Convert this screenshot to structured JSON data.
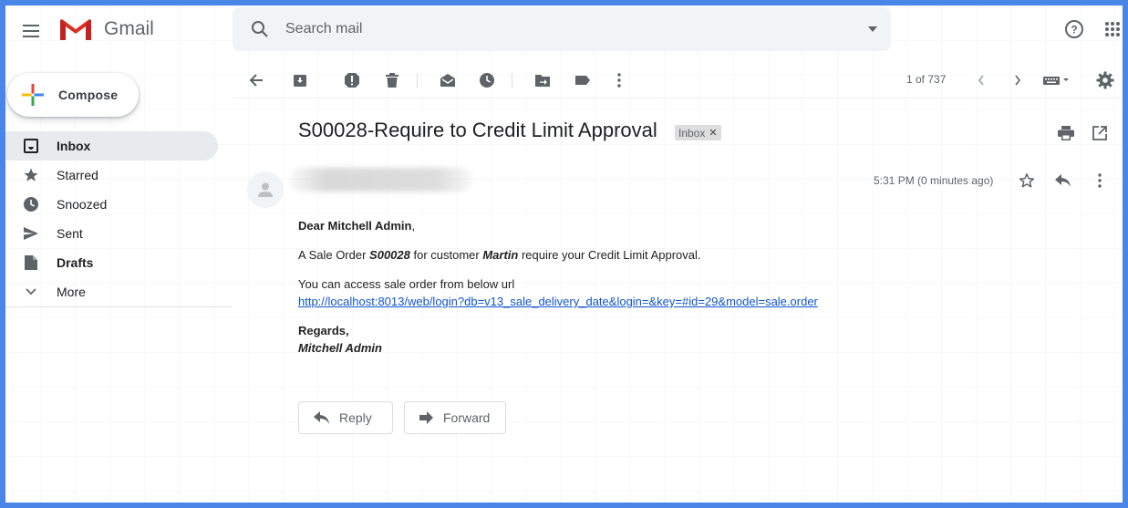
{
  "app": {
    "name": "Gmail"
  },
  "search": {
    "placeholder": "Search mail"
  },
  "compose": {
    "label": "Compose"
  },
  "sidebar": {
    "items": [
      {
        "label": "Inbox",
        "icon": "inbox-icon",
        "active": true
      },
      {
        "label": "Starred",
        "icon": "star-icon"
      },
      {
        "label": "Snoozed",
        "icon": "clock-icon"
      },
      {
        "label": "Sent",
        "icon": "send-icon"
      },
      {
        "label": "Drafts",
        "icon": "draft-icon"
      },
      {
        "label": "More",
        "icon": "chevron-down-icon"
      }
    ]
  },
  "toolbar": {
    "pager": "1 of 737"
  },
  "message": {
    "subject": "S00028-Require to Credit Limit Approval",
    "label_badge": "Inbox",
    "time": "5:31 PM (0 minutes ago)",
    "greeting_name": "Dear Mitchell Admin",
    "greeting_punct": ",",
    "line1_pre": "A Sale Order ",
    "line1_order": "S00028",
    "line1_mid": " for customer ",
    "line1_customer": "Martin",
    "line1_post": " require your Credit Limit Approval.",
    "line2": "You can access sale order from below url",
    "link": "http://localhost:8013/web/login?db=v13_sale_delivery_date&login=&key=#id=29&model=sale.order",
    "regards": "Regards,",
    "signature": "Mitchell Admin"
  },
  "actions": {
    "reply": "Reply",
    "forward": "Forward"
  },
  "colors": {
    "accent": "#4a86e8",
    "link": "#1155cc",
    "active_nav": "#e8eaed"
  }
}
